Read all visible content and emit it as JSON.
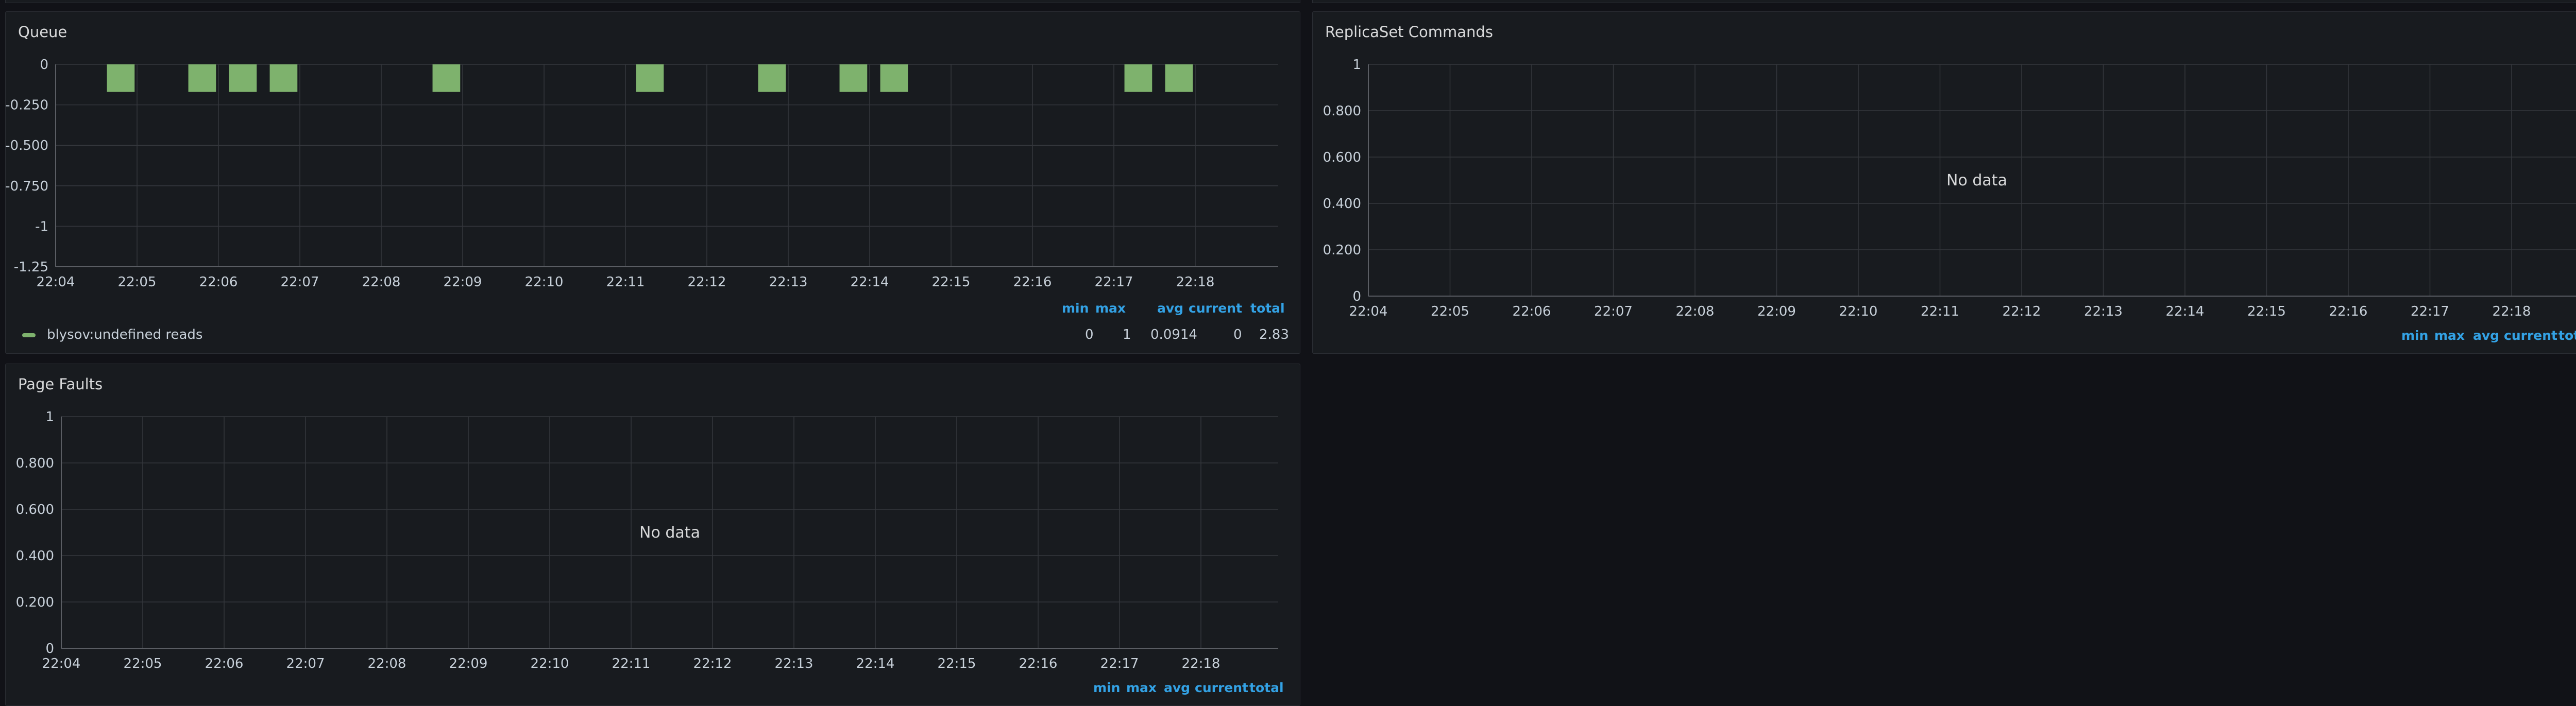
{
  "colors": {
    "background": "#111217",
    "panel": "#181b1f",
    "grid": "#34373d",
    "legend_header": "#33a2e5",
    "series_green": "#7eb26d"
  },
  "panels": {
    "queue": {
      "title": "Queue",
      "legend": {
        "headers": [
          "min",
          "max",
          "avg",
          "current",
          "total"
        ],
        "series_name": "blysov:undefined reads",
        "values": [
          "0",
          "1",
          "0.0914",
          "0",
          "2.83"
        ]
      }
    },
    "replicaset": {
      "title": "ReplicaSet Commands",
      "no_data": "No data",
      "legend": {
        "headers": [
          "min",
          "max",
          "avg",
          "current",
          "total"
        ]
      }
    },
    "page_faults": {
      "title": "Page Faults",
      "no_data": "No data",
      "legend": {
        "headers": [
          "min",
          "max",
          "avg",
          "current",
          "total"
        ]
      }
    }
  },
  "chart_data": [
    {
      "type": "bar",
      "panel": "queue",
      "x_ticks": [
        "22:04",
        "22:05",
        "22:06",
        "22:07",
        "22:08",
        "22:09",
        "22:10",
        "22:11",
        "22:12",
        "22:13",
        "22:14",
        "22:15",
        "22:16",
        "22:17",
        "22:18"
      ],
      "y_ticks": [
        "0",
        "-0.250",
        "-0.500",
        "-0.750",
        "-1",
        "-1.25"
      ],
      "ylim": [
        -1.25,
        0
      ],
      "grid": true,
      "legend_placement": "bottom",
      "series": [
        {
          "name": "blysov:undefined reads",
          "color": "#7eb26d",
          "points": [
            {
              "x": 0.8,
              "y": -0.17
            },
            {
              "x": 1.8,
              "y": -0.17
            },
            {
              "x": 2.3,
              "y": -0.17
            },
            {
              "x": 2.8,
              "y": -0.17
            },
            {
              "x": 4.8,
              "y": -0.17
            },
            {
              "x": 7.3,
              "y": -0.17
            },
            {
              "x": 8.8,
              "y": -0.17
            },
            {
              "x": 9.8,
              "y": -0.17
            },
            {
              "x": 10.3,
              "y": -0.17
            },
            {
              "x": 13.3,
              "y": -0.17
            },
            {
              "x": 13.8,
              "y": -0.17
            }
          ]
        }
      ]
    },
    {
      "type": "line",
      "panel": "replicaset",
      "x_ticks": [
        "22:04",
        "22:05",
        "22:06",
        "22:07",
        "22:08",
        "22:09",
        "22:10",
        "22:11",
        "22:12",
        "22:13",
        "22:14",
        "22:15",
        "22:16",
        "22:17",
        "22:18"
      ],
      "y_ticks": [
        "1",
        "0.800",
        "0.600",
        "0.400",
        "0.200",
        "0"
      ],
      "ylim": [
        0,
        1
      ],
      "grid": true,
      "series": []
    },
    {
      "type": "line",
      "panel": "page_faults",
      "x_ticks": [
        "22:04",
        "22:05",
        "22:06",
        "22:07",
        "22:08",
        "22:09",
        "22:10",
        "22:11",
        "22:12",
        "22:13",
        "22:14",
        "22:15",
        "22:16",
        "22:17",
        "22:18"
      ],
      "y_ticks": [
        "1",
        "0.800",
        "0.600",
        "0.400",
        "0.200",
        "0"
      ],
      "ylim": [
        0,
        1
      ],
      "grid": true,
      "series": []
    }
  ]
}
